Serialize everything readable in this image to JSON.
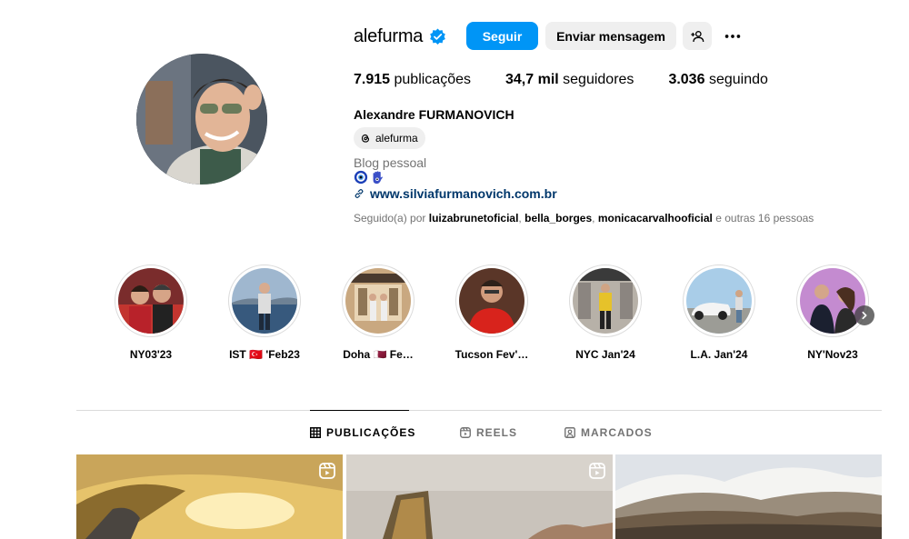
{
  "profile": {
    "username": "alefurma",
    "full_name": "Alexandre FURMANOVICH",
    "threads_handle": "alefurma",
    "category": "Blog pessoal",
    "bio_emojis": [
      "🧿",
      "🪬"
    ],
    "website": "www.silviafurmanovich.com.br"
  },
  "actions": {
    "follow_label": "Seguir",
    "message_label": "Enviar mensagem"
  },
  "stats": {
    "posts_count": "7.915",
    "posts_label": "publicações",
    "followers_count": "34,7 mil",
    "followers_label": "seguidores",
    "following_count": "3.036",
    "following_label": "seguindo"
  },
  "followed_by": {
    "prefix": "Seguido(a) por",
    "accounts": [
      "luizabrunetoficial",
      "bella_borges",
      "monicacarvalhooficial"
    ],
    "suffix": "e outras 16 pessoas"
  },
  "highlights": [
    {
      "label": "NY03'23"
    },
    {
      "label": "IST 🇹🇷 'Feb23"
    },
    {
      "label": "Doha 🇶🇦 Fe…"
    },
    {
      "label": "Tucson Fev'…"
    },
    {
      "label": "NYC Jan'24"
    },
    {
      "label": "L.A. Jan'24"
    },
    {
      "label": "NY'Nov23"
    }
  ],
  "tabs": [
    {
      "label": "PUBLICAÇÕES",
      "icon": "grid-icon",
      "active": true
    },
    {
      "label": "REELS",
      "icon": "reels-icon",
      "active": false
    },
    {
      "label": "MARCADOS",
      "icon": "tagged-icon",
      "active": false
    }
  ],
  "colors": {
    "accent": "#0095f6",
    "link": "#00376b",
    "secondary_text": "#737373",
    "button_gray": "#efefef",
    "verified": "#0095f6"
  }
}
